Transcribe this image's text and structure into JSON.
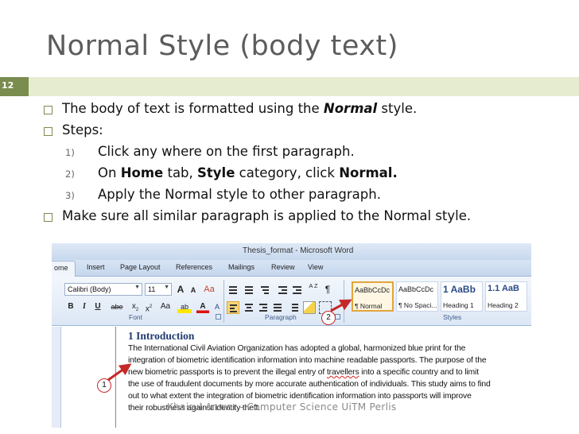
{
  "slide": {
    "title": "Normal Style (body text)",
    "number": "12",
    "footer": "Khairul Anwar - Computer Science UiTM Perlis",
    "accent_color": "#7a8c4e",
    "bar_color": "#e6ecd0"
  },
  "bullets": {
    "b1": {
      "pre": "The body of text is formatted using the ",
      "bold": "Normal",
      "post": " style."
    },
    "b2": "Steps:",
    "steps": [
      {
        "num": "1)",
        "text": "Click any where on the first paragraph."
      },
      {
        "num": "2)",
        "t1": "On ",
        "b1": "Home",
        "t2": " tab, ",
        "b2": "Style",
        "t3": " category, click ",
        "b3": "Normal."
      },
      {
        "num": "3)",
        "text": "Apply the Normal style to other paragraph."
      }
    ],
    "b3": "Make sure all similar paragraph is applied to the Normal style."
  },
  "word": {
    "window_title": "Thesis_format - Microsoft Word",
    "tabs": [
      "ome",
      "Insert",
      "Page Layout",
      "References",
      "Mailings",
      "Review",
      "View"
    ],
    "font_name": "Calibri (Body)",
    "font_size": "11",
    "grow_font": "A",
    "shrink_font": "A",
    "clear_format": "Aa",
    "bold": "B",
    "italic": "I",
    "underline": "U",
    "strike": "abe",
    "subscript": "x",
    "superscript": "x",
    "change_case": "Aa",
    "highlight": "ab",
    "font_color": "A",
    "phonetic": "A",
    "sort": "A Z",
    "pilcrow": "¶",
    "group_font": "Font",
    "group_paragraph": "Paragraph",
    "group_styles": "Styles",
    "styles": [
      {
        "preview": "AaBbCcDc",
        "name": "¶ Normal"
      },
      {
        "preview": "AaBbCcDc",
        "name": "¶ No Spaci..."
      },
      {
        "preview": "1  AaBb",
        "name": "Heading 1"
      },
      {
        "preview": "1.1  AaB",
        "name": "Heading 2"
      }
    ],
    "doc": {
      "heading": "1   Introduction",
      "l1": "The International Civil Aviation Organization has adopted a global, harmonized blue print for the",
      "l2": "integration of biometric identification information into machine readable passports. The purpose of the",
      "l3a": "new biometric passports is to prevent the illegal entry of ",
      "l3b": "travellers",
      "l3c": " into a specific country and to limit",
      "l4": "the use of fraudulent documents by more accurate authentication of individuals. This study aims to find",
      "l5": "out to what extent the integration of biometric identification information into passports will improve",
      "l6": "their robustness against identity theft."
    },
    "callout1": "1",
    "callout2": "2",
    "callout_color": "#c62828"
  }
}
